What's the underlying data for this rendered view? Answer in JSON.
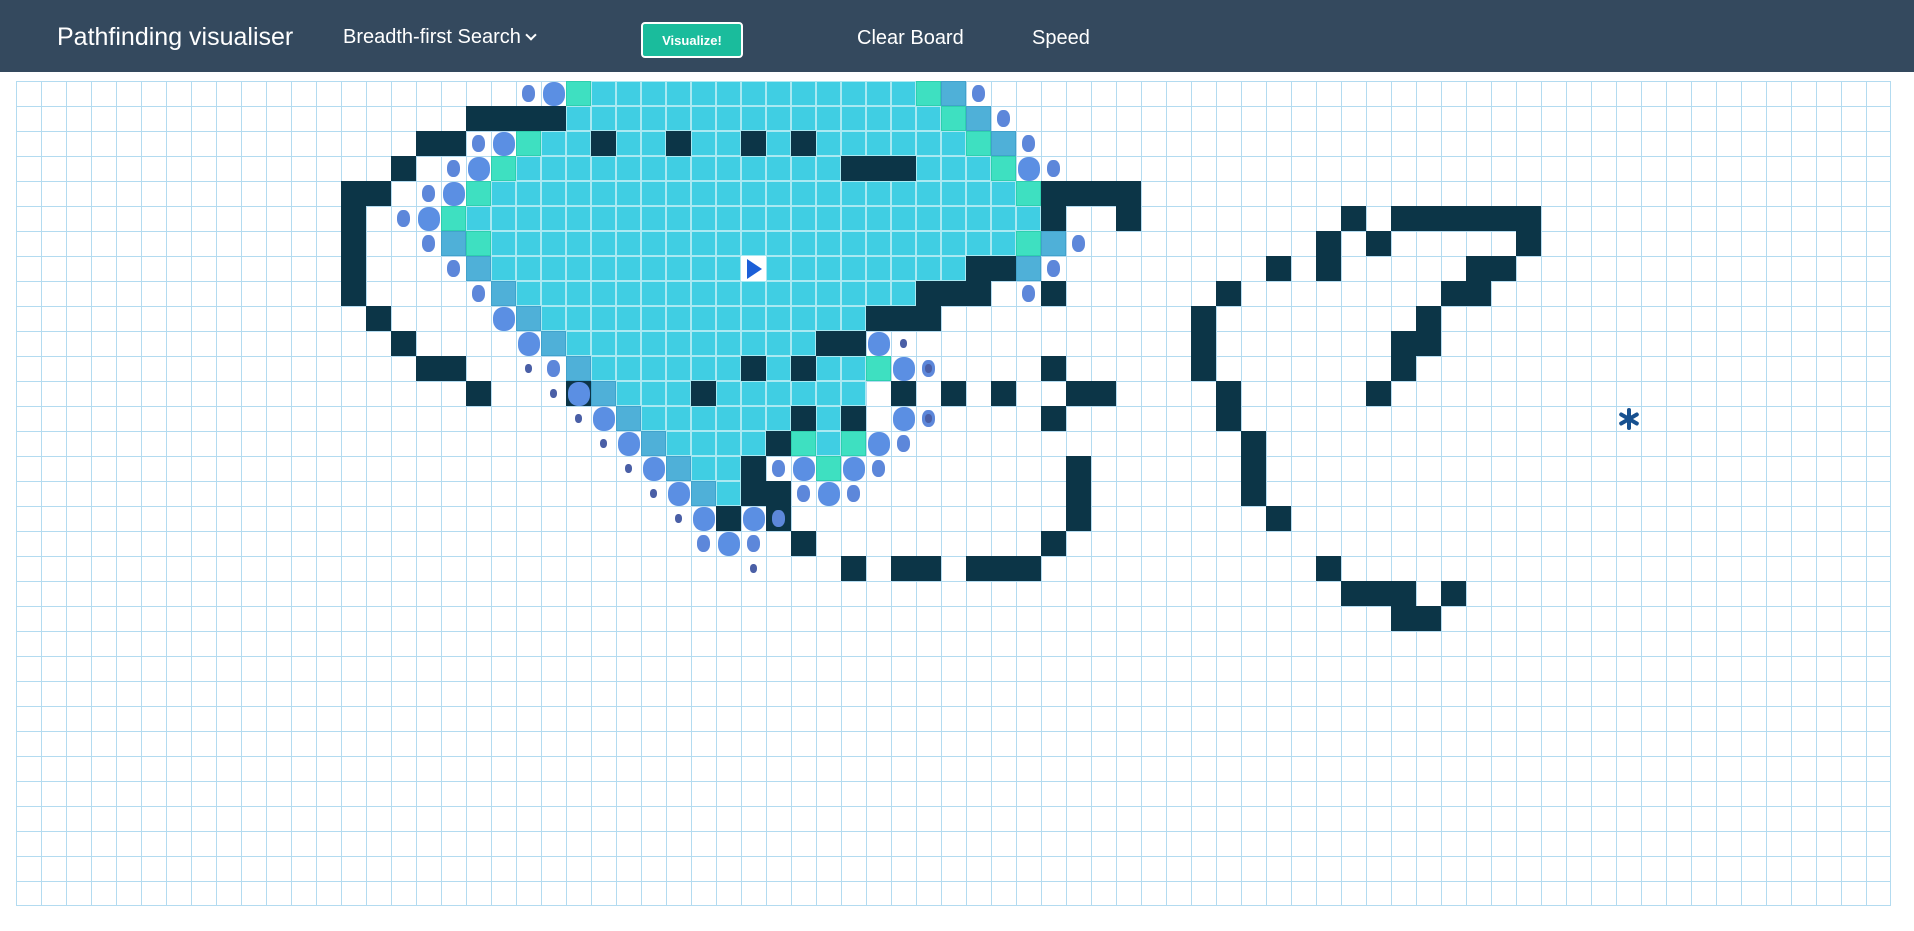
{
  "navbar": {
    "brand": "Pathfinding visualiser",
    "algorithm": "Breadth-first Search",
    "visualize_label": "Visualize!",
    "clear_label": "Clear Board",
    "speed_label": "Speed"
  },
  "grid": {
    "cols": 75,
    "rows": 33,
    "start": [
      29,
      7
    ],
    "target": [
      64,
      13
    ],
    "walls": [
      [
        18,
        1
      ],
      [
        19,
        1
      ],
      [
        20,
        1
      ],
      [
        21,
        1
      ],
      [
        16,
        2
      ],
      [
        17,
        2
      ],
      [
        23,
        2
      ],
      [
        26,
        2
      ],
      [
        29,
        2
      ],
      [
        31,
        2
      ],
      [
        15,
        3
      ],
      [
        33,
        3
      ],
      [
        34,
        3
      ],
      [
        35,
        3
      ],
      [
        13,
        4
      ],
      [
        14,
        4
      ],
      [
        41,
        4
      ],
      [
        42,
        4
      ],
      [
        43,
        4
      ],
      [
        44,
        4
      ],
      [
        13,
        5
      ],
      [
        41,
        5
      ],
      [
        44,
        5
      ],
      [
        53,
        5
      ],
      [
        55,
        5
      ],
      [
        56,
        5
      ],
      [
        57,
        5
      ],
      [
        58,
        5
      ],
      [
        59,
        5
      ],
      [
        60,
        5
      ],
      [
        13,
        6
      ],
      [
        52,
        6
      ],
      [
        54,
        6
      ],
      [
        60,
        6
      ],
      [
        13,
        7
      ],
      [
        38,
        7
      ],
      [
        39,
        7
      ],
      [
        50,
        7
      ],
      [
        52,
        7
      ],
      [
        58,
        7
      ],
      [
        59,
        7
      ],
      [
        13,
        8
      ],
      [
        36,
        8
      ],
      [
        37,
        8
      ],
      [
        38,
        8
      ],
      [
        41,
        8
      ],
      [
        48,
        8
      ],
      [
        57,
        8
      ],
      [
        58,
        8
      ],
      [
        14,
        9
      ],
      [
        34,
        9
      ],
      [
        35,
        9
      ],
      [
        36,
        9
      ],
      [
        47,
        9
      ],
      [
        56,
        9
      ],
      [
        15,
        10
      ],
      [
        32,
        10
      ],
      [
        33,
        10
      ],
      [
        47,
        10
      ],
      [
        55,
        10
      ],
      [
        56,
        10
      ],
      [
        16,
        11
      ],
      [
        17,
        11
      ],
      [
        29,
        11
      ],
      [
        31,
        11
      ],
      [
        41,
        11
      ],
      [
        47,
        11
      ],
      [
        55,
        11
      ],
      [
        18,
        12
      ],
      [
        22,
        12
      ],
      [
        27,
        12
      ],
      [
        35,
        12
      ],
      [
        37,
        12
      ],
      [
        39,
        12
      ],
      [
        42,
        12
      ],
      [
        43,
        12
      ],
      [
        48,
        12
      ],
      [
        54,
        12
      ],
      [
        31,
        13
      ],
      [
        33,
        13
      ],
      [
        41,
        13
      ],
      [
        48,
        13
      ],
      [
        30,
        14
      ],
      [
        49,
        14
      ],
      [
        29,
        15
      ],
      [
        42,
        15
      ],
      [
        49,
        15
      ],
      [
        29,
        16
      ],
      [
        30,
        16
      ],
      [
        42,
        16
      ],
      [
        49,
        16
      ],
      [
        28,
        17
      ],
      [
        30,
        17
      ],
      [
        42,
        17
      ],
      [
        50,
        17
      ],
      [
        31,
        18
      ],
      [
        41,
        18
      ],
      [
        33,
        19
      ],
      [
        35,
        19
      ],
      [
        36,
        19
      ],
      [
        38,
        19
      ],
      [
        39,
        19
      ],
      [
        40,
        19
      ],
      [
        52,
        19
      ],
      [
        53,
        20
      ],
      [
        54,
        20
      ],
      [
        55,
        20
      ],
      [
        57,
        20
      ],
      [
        55,
        21
      ],
      [
        56,
        21
      ]
    ],
    "visited": [
      [
        23,
        0
      ],
      [
        24,
        0
      ],
      [
        25,
        0
      ],
      [
        26,
        0
      ],
      [
        27,
        0
      ],
      [
        28,
        0
      ],
      [
        29,
        0
      ],
      [
        30,
        0
      ],
      [
        31,
        0
      ],
      [
        32,
        0
      ],
      [
        33,
        0
      ],
      [
        34,
        0
      ],
      [
        35,
        0
      ],
      [
        22,
        1
      ],
      [
        23,
        1
      ],
      [
        24,
        1
      ],
      [
        25,
        1
      ],
      [
        26,
        1
      ],
      [
        27,
        1
      ],
      [
        28,
        1
      ],
      [
        29,
        1
      ],
      [
        30,
        1
      ],
      [
        31,
        1
      ],
      [
        32,
        1
      ],
      [
        33,
        1
      ],
      [
        34,
        1
      ],
      [
        35,
        1
      ],
      [
        36,
        1
      ],
      [
        21,
        2
      ],
      [
        22,
        2
      ],
      [
        24,
        2
      ],
      [
        25,
        2
      ],
      [
        27,
        2
      ],
      [
        28,
        2
      ],
      [
        30,
        2
      ],
      [
        32,
        2
      ],
      [
        33,
        2
      ],
      [
        34,
        2
      ],
      [
        35,
        2
      ],
      [
        36,
        2
      ],
      [
        37,
        2
      ],
      [
        20,
        3
      ],
      [
        21,
        3
      ],
      [
        22,
        3
      ],
      [
        23,
        3
      ],
      [
        24,
        3
      ],
      [
        25,
        3
      ],
      [
        26,
        3
      ],
      [
        27,
        3
      ],
      [
        28,
        3
      ],
      [
        29,
        3
      ],
      [
        30,
        3
      ],
      [
        31,
        3
      ],
      [
        32,
        3
      ],
      [
        36,
        3
      ],
      [
        37,
        3
      ],
      [
        38,
        3
      ],
      [
        19,
        4
      ],
      [
        20,
        4
      ],
      [
        21,
        4
      ],
      [
        22,
        4
      ],
      [
        23,
        4
      ],
      [
        24,
        4
      ],
      [
        25,
        4
      ],
      [
        26,
        4
      ],
      [
        27,
        4
      ],
      [
        28,
        4
      ],
      [
        29,
        4
      ],
      [
        30,
        4
      ],
      [
        31,
        4
      ],
      [
        32,
        4
      ],
      [
        33,
        4
      ],
      [
        34,
        4
      ],
      [
        35,
        4
      ],
      [
        36,
        4
      ],
      [
        37,
        4
      ],
      [
        38,
        4
      ],
      [
        39,
        4
      ],
      [
        18,
        5
      ],
      [
        19,
        5
      ],
      [
        20,
        5
      ],
      [
        21,
        5
      ],
      [
        22,
        5
      ],
      [
        23,
        5
      ],
      [
        24,
        5
      ],
      [
        25,
        5
      ],
      [
        26,
        5
      ],
      [
        27,
        5
      ],
      [
        28,
        5
      ],
      [
        29,
        5
      ],
      [
        30,
        5
      ],
      [
        31,
        5
      ],
      [
        32,
        5
      ],
      [
        33,
        5
      ],
      [
        34,
        5
      ],
      [
        35,
        5
      ],
      [
        36,
        5
      ],
      [
        37,
        5
      ],
      [
        38,
        5
      ],
      [
        39,
        5
      ],
      [
        40,
        5
      ],
      [
        19,
        6
      ],
      [
        20,
        6
      ],
      [
        21,
        6
      ],
      [
        22,
        6
      ],
      [
        23,
        6
      ],
      [
        24,
        6
      ],
      [
        25,
        6
      ],
      [
        26,
        6
      ],
      [
        27,
        6
      ],
      [
        28,
        6
      ],
      [
        29,
        6
      ],
      [
        30,
        6
      ],
      [
        31,
        6
      ],
      [
        32,
        6
      ],
      [
        33,
        6
      ],
      [
        34,
        6
      ],
      [
        35,
        6
      ],
      [
        36,
        6
      ],
      [
        37,
        6
      ],
      [
        38,
        6
      ],
      [
        39,
        6
      ],
      [
        19,
        7
      ],
      [
        20,
        7
      ],
      [
        21,
        7
      ],
      [
        22,
        7
      ],
      [
        23,
        7
      ],
      [
        24,
        7
      ],
      [
        25,
        7
      ],
      [
        26,
        7
      ],
      [
        27,
        7
      ],
      [
        28,
        7
      ],
      [
        29,
        7
      ],
      [
        30,
        7
      ],
      [
        31,
        7
      ],
      [
        32,
        7
      ],
      [
        33,
        7
      ],
      [
        34,
        7
      ],
      [
        35,
        7
      ],
      [
        36,
        7
      ],
      [
        37,
        7
      ],
      [
        20,
        8
      ],
      [
        21,
        8
      ],
      [
        22,
        8
      ],
      [
        23,
        8
      ],
      [
        24,
        8
      ],
      [
        25,
        8
      ],
      [
        26,
        8
      ],
      [
        27,
        8
      ],
      [
        28,
        8
      ],
      [
        29,
        8
      ],
      [
        30,
        8
      ],
      [
        31,
        8
      ],
      [
        32,
        8
      ],
      [
        33,
        8
      ],
      [
        34,
        8
      ],
      [
        35,
        8
      ],
      [
        21,
        9
      ],
      [
        22,
        9
      ],
      [
        23,
        9
      ],
      [
        24,
        9
      ],
      [
        25,
        9
      ],
      [
        26,
        9
      ],
      [
        27,
        9
      ],
      [
        28,
        9
      ],
      [
        29,
        9
      ],
      [
        30,
        9
      ],
      [
        31,
        9
      ],
      [
        32,
        9
      ],
      [
        33,
        9
      ],
      [
        22,
        10
      ],
      [
        23,
        10
      ],
      [
        24,
        10
      ],
      [
        25,
        10
      ],
      [
        26,
        10
      ],
      [
        27,
        10
      ],
      [
        28,
        10
      ],
      [
        29,
        10
      ],
      [
        30,
        10
      ],
      [
        31,
        10
      ],
      [
        23,
        11
      ],
      [
        24,
        11
      ],
      [
        25,
        11
      ],
      [
        26,
        11
      ],
      [
        27,
        11
      ],
      [
        28,
        11
      ],
      [
        30,
        11
      ],
      [
        32,
        11
      ],
      [
        33,
        11
      ],
      [
        23,
        12
      ],
      [
        24,
        12
      ],
      [
        25,
        12
      ],
      [
        26,
        12
      ],
      [
        28,
        12
      ],
      [
        29,
        12
      ],
      [
        30,
        12
      ],
      [
        31,
        12
      ],
      [
        32,
        12
      ],
      [
        33,
        12
      ],
      [
        24,
        13
      ],
      [
        25,
        13
      ],
      [
        26,
        13
      ],
      [
        27,
        13
      ],
      [
        28,
        13
      ],
      [
        29,
        13
      ],
      [
        30,
        13
      ],
      [
        32,
        13
      ],
      [
        25,
        14
      ],
      [
        26,
        14
      ],
      [
        27,
        14
      ],
      [
        28,
        14
      ],
      [
        29,
        14
      ],
      [
        31,
        14
      ],
      [
        32,
        14
      ],
      [
        26,
        15
      ],
      [
        27,
        15
      ],
      [
        28,
        15
      ],
      [
        27,
        16
      ],
      [
        28,
        16
      ]
    ],
    "frontier": [
      [
        22,
        0
      ],
      [
        36,
        0
      ],
      [
        37,
        1
      ],
      [
        20,
        2
      ],
      [
        38,
        2
      ],
      [
        19,
        3
      ],
      [
        39,
        3
      ],
      [
        18,
        4
      ],
      [
        40,
        4
      ],
      [
        17,
        5
      ],
      [
        18,
        6
      ],
      [
        40,
        6
      ],
      [
        34,
        11
      ],
      [
        33,
        13
      ],
      [
        31,
        14
      ],
      [
        33,
        14
      ],
      [
        32,
        15
      ],
      [
        28,
        17
      ]
    ],
    "queued": [
      [
        37,
        0
      ],
      [
        38,
        1
      ],
      [
        39,
        2
      ],
      [
        17,
        6
      ],
      [
        41,
        6
      ],
      [
        18,
        7
      ],
      [
        40,
        7
      ],
      [
        19,
        8
      ],
      [
        20,
        9
      ],
      [
        21,
        10
      ],
      [
        22,
        11
      ],
      [
        23,
        12
      ],
      [
        24,
        13
      ],
      [
        25,
        14
      ],
      [
        26,
        15
      ],
      [
        27,
        16
      ]
    ],
    "dots_large": [
      [
        21,
        0
      ],
      [
        19,
        2
      ],
      [
        18,
        3
      ],
      [
        40,
        3
      ],
      [
        17,
        4
      ],
      [
        16,
        5
      ],
      [
        19,
        9
      ],
      [
        20,
        10
      ],
      [
        34,
        10
      ],
      [
        35,
        11
      ],
      [
        22,
        12
      ],
      [
        23,
        13
      ],
      [
        35,
        13
      ],
      [
        24,
        14
      ],
      [
        34,
        14
      ],
      [
        25,
        15
      ],
      [
        31,
        15
      ],
      [
        33,
        15
      ],
      [
        26,
        16
      ],
      [
        32,
        16
      ],
      [
        27,
        17
      ],
      [
        29,
        17
      ],
      [
        28,
        18
      ]
    ],
    "dots_medium": [
      [
        20,
        0
      ],
      [
        38,
        0
      ],
      [
        39,
        1
      ],
      [
        18,
        2
      ],
      [
        40,
        2
      ],
      [
        17,
        3
      ],
      [
        41,
        3
      ],
      [
        16,
        4
      ],
      [
        15,
        5
      ],
      [
        16,
        6
      ],
      [
        42,
        6
      ],
      [
        17,
        7
      ],
      [
        41,
        7
      ],
      [
        18,
        8
      ],
      [
        40,
        8
      ],
      [
        21,
        11
      ],
      [
        36,
        11
      ],
      [
        36,
        13
      ],
      [
        35,
        14
      ],
      [
        30,
        15
      ],
      [
        34,
        15
      ],
      [
        31,
        16
      ],
      [
        33,
        16
      ],
      [
        30,
        17
      ],
      [
        27,
        18
      ],
      [
        29,
        18
      ]
    ],
    "dots_small": [
      [
        35,
        10
      ],
      [
        20,
        11
      ],
      [
        36,
        11
      ],
      [
        21,
        12
      ],
      [
        36,
        13
      ],
      [
        22,
        13
      ],
      [
        23,
        14
      ],
      [
        24,
        15
      ],
      [
        25,
        16
      ],
      [
        26,
        17
      ],
      [
        29,
        19
      ]
    ]
  }
}
